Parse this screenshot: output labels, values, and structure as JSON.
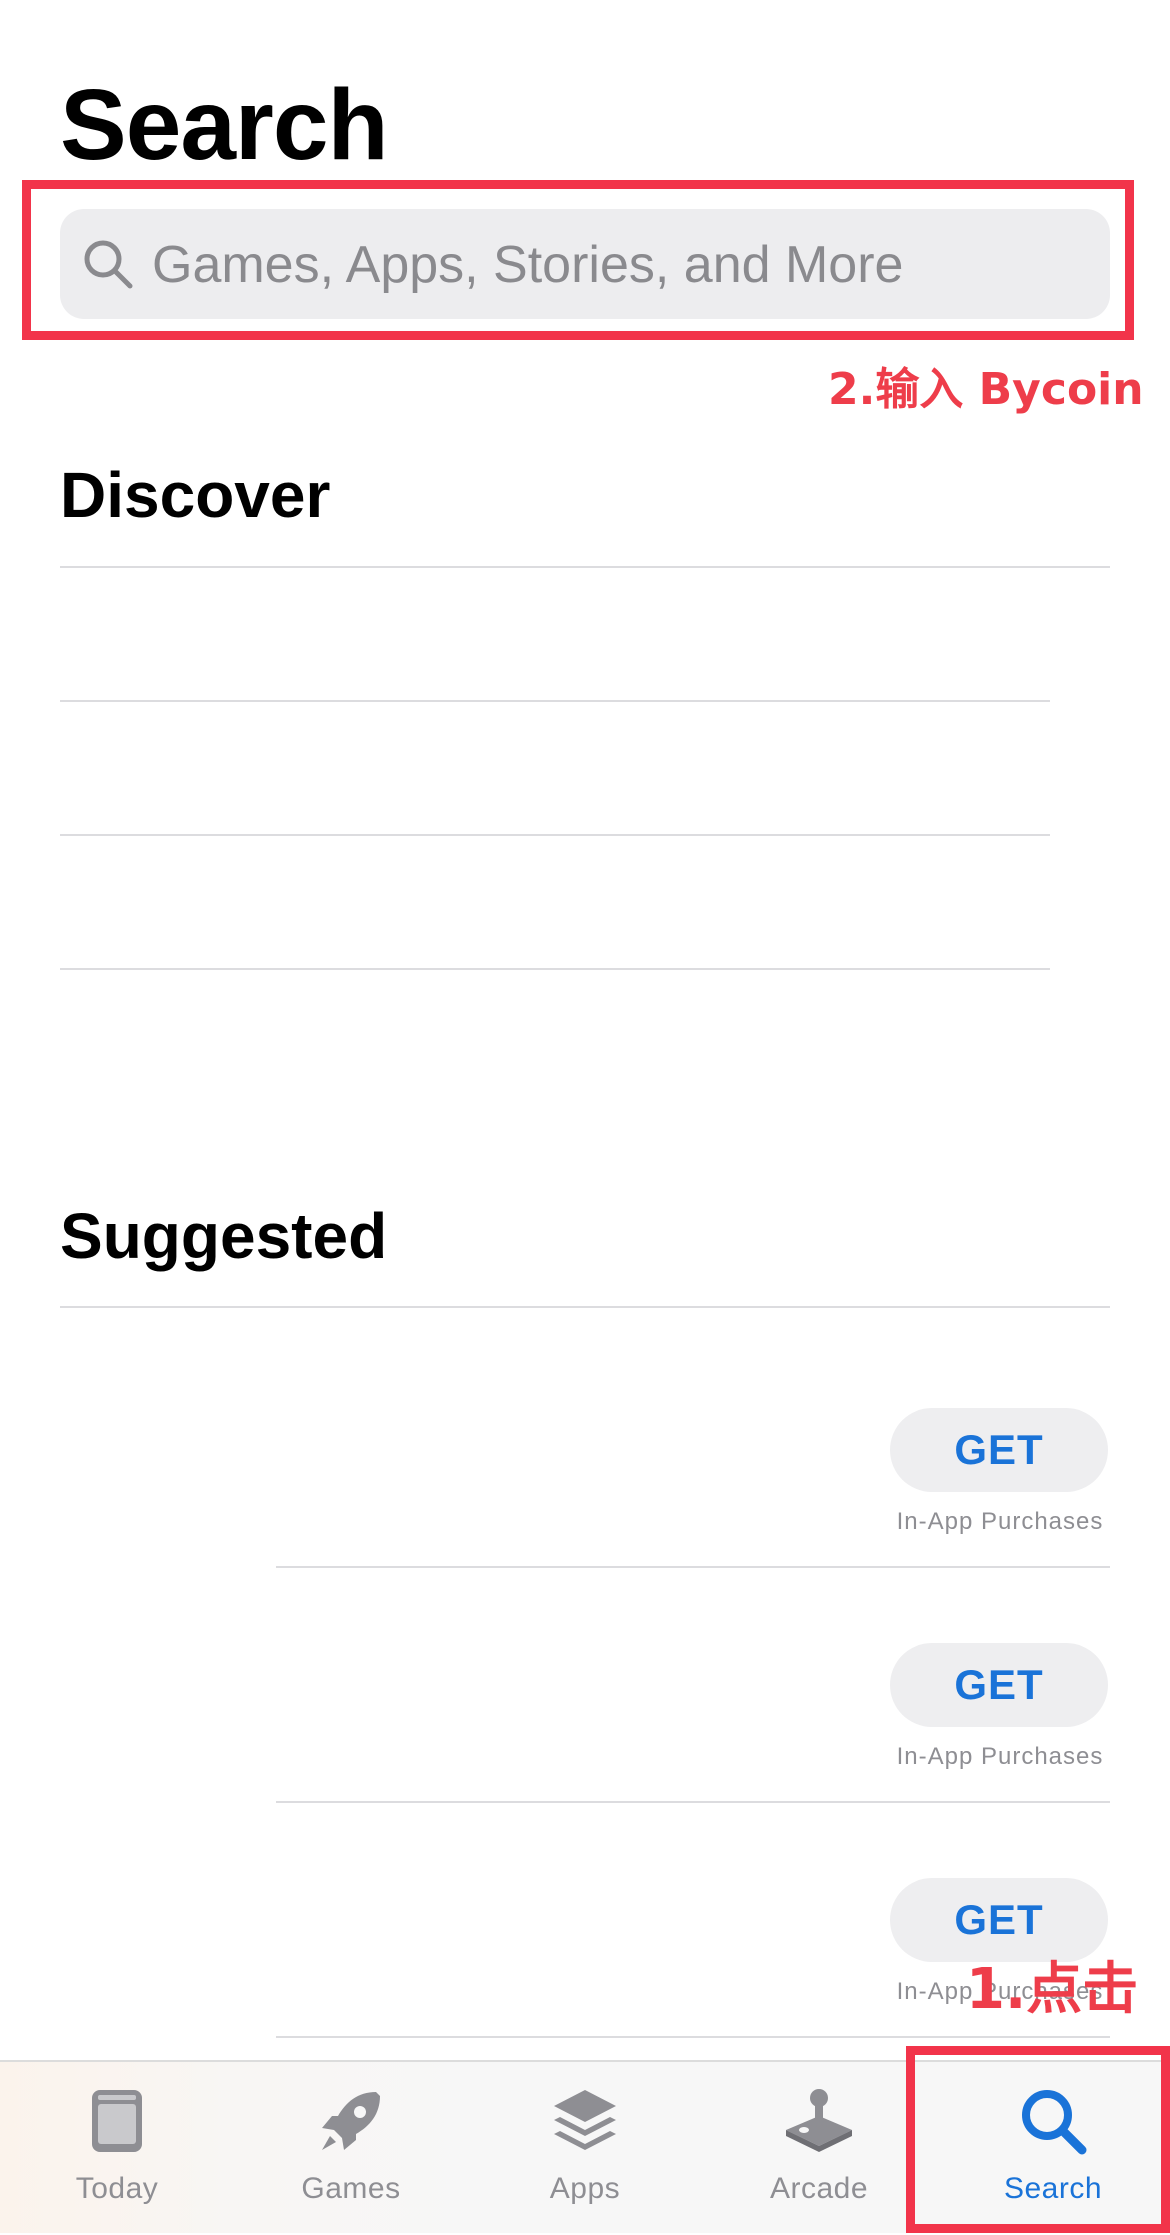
{
  "page": {
    "title": "Search"
  },
  "search": {
    "placeholder": "Games, Apps, Stories, and More"
  },
  "annotations": {
    "step1": "1.点击",
    "step2": "2.输入 Bycoin",
    "color": "#f2344a"
  },
  "discover": {
    "title": "Discover"
  },
  "suggested": {
    "title": "Suggested",
    "items": [
      {
        "button_label": "GET",
        "note": "In-App Purchases"
      },
      {
        "button_label": "GET",
        "note": "In-App Purchases"
      },
      {
        "button_label": "GET",
        "note": "In-App Purchases"
      }
    ]
  },
  "tab_bar": {
    "tabs": [
      {
        "label": "Today",
        "icon": "today-icon"
      },
      {
        "label": "Games",
        "icon": "rocket-icon"
      },
      {
        "label": "Apps",
        "icon": "layers-icon"
      },
      {
        "label": "Arcade",
        "icon": "joystick-icon"
      },
      {
        "label": "Search",
        "icon": "search-icon",
        "active": true
      }
    ]
  },
  "colors": {
    "accent": "#1a73d8",
    "inactive": "#8e8e93",
    "annotation": "#f2344a"
  }
}
